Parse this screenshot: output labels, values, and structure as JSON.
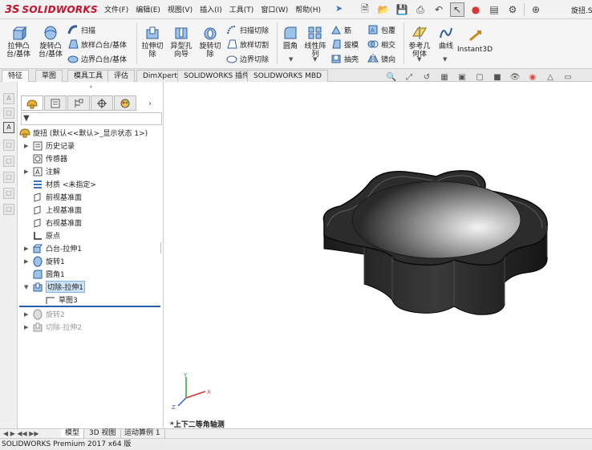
{
  "app": {
    "brand_prefix": "3S",
    "brand": "SOLIDWORKS",
    "doc_title": "旋扭.SL"
  },
  "menus": [
    "文件(F)",
    "编辑(E)",
    "视图(V)",
    "插入(I)",
    "工具(T)",
    "窗口(W)",
    "帮助(H)"
  ],
  "ribbon": {
    "extrude_boss": "拉伸凸\n台/基体",
    "revolve_boss": "旋转凸\n台/基体",
    "sweep": "扫描",
    "loft": "放样凸台/基体",
    "boundary_boss": "边界凸台/基体",
    "extrude_cut": "拉伸切\n除",
    "hole_wizard": "异型孔\n向导",
    "revolve_cut": "旋转切\n除",
    "swept_cut": "扫描切除",
    "lofted_cut": "放样切割",
    "boundary_cut": "边界切除",
    "fillet": "圆角",
    "linear_pattern": "线性阵\n列",
    "rib": "筋",
    "draft": "拔模",
    "shell": "抽壳",
    "wrap": "包覆",
    "intersect": "相交",
    "mirror": "镜向",
    "ref_geometry": "参考几\n何体",
    "curves": "曲线",
    "instant3d": "Instant3D"
  },
  "tabs": [
    "特征",
    "草图",
    "模具工具",
    "评估",
    "DimXpert",
    "SOLIDWORKS 插件",
    "SOLIDWORKS MBD"
  ],
  "tree": {
    "root": "旋扭  (默认<<默认>_显示状态 1>)",
    "items": [
      {
        "label": "历史记录",
        "icon": "history-icon"
      },
      {
        "label": "传感器",
        "icon": "sensor-icon"
      },
      {
        "label": "注解",
        "icon": "annotation-icon"
      },
      {
        "label": "材质 <未指定>",
        "icon": "material-icon"
      },
      {
        "label": "前视基准面",
        "icon": "plane-icon"
      },
      {
        "label": "上视基准面",
        "icon": "plane-icon"
      },
      {
        "label": "右视基准面",
        "icon": "plane-icon"
      },
      {
        "label": "原点",
        "icon": "origin-icon"
      },
      {
        "label": "凸台-拉伸1",
        "icon": "extrude-icon"
      },
      {
        "label": "旋转1",
        "icon": "revolve-icon"
      },
      {
        "label": "圆角1",
        "icon": "fillet-icon"
      },
      {
        "label": "切除-拉伸1",
        "icon": "cut-extrude-icon"
      },
      {
        "label": "草图3",
        "icon": "sketch-icon"
      },
      {
        "label": "旋转2",
        "icon": "revolve-icon"
      },
      {
        "label": "切除-拉伸2",
        "icon": "cut-extrude-icon"
      }
    ]
  },
  "viewport": {
    "view_name": "*上下二等角轴测",
    "triad_x": "X",
    "triad_y": "Y",
    "triad_z": "Z"
  },
  "bottom_tabs": [
    "模型",
    "3D 视图",
    "运动算例 1"
  ],
  "status": "SOLIDWORKS Premium 2017 x64 版",
  "colors": {
    "brand_red": "#c8102e",
    "selection": "#cde2f7",
    "rollback_bar": "#2b5fad"
  }
}
